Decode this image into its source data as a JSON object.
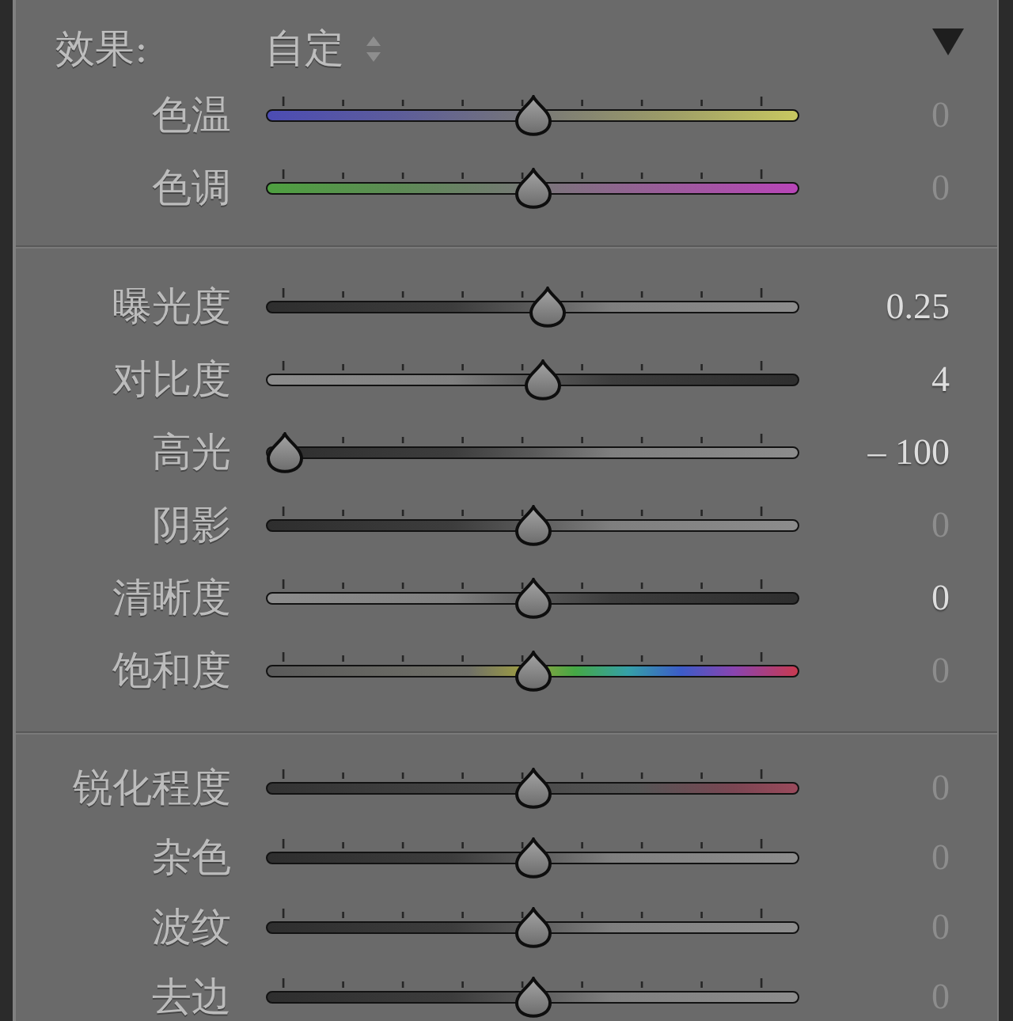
{
  "header": {
    "label": "效果:",
    "preset": "自定"
  },
  "groups": [
    {
      "sliders": [
        {
          "label": "色温",
          "kind": "temperature",
          "level": 0.5,
          "value": "0",
          "highlighted": false
        },
        {
          "label": "色调",
          "kind": "tint",
          "level": 0.5,
          "value": "0",
          "highlighted": false
        }
      ]
    },
    {
      "sliders": [
        {
          "label": "曝光度",
          "kind": "dark-to-light",
          "level": 0.53,
          "value": "0.25",
          "highlighted": true
        },
        {
          "label": "对比度",
          "kind": "light-to-dark",
          "level": 0.52,
          "value": "4",
          "highlighted": true
        },
        {
          "label": "高光",
          "kind": "dark-to-light",
          "level": 0,
          "value": "– 100",
          "highlighted": true
        },
        {
          "label": "阴影",
          "kind": "dark-to-light",
          "level": 0.5,
          "value": "0",
          "highlighted": false
        },
        {
          "label": "清晰度",
          "kind": "light-to-dark",
          "level": 0.5,
          "value": "0",
          "highlighted": true
        },
        {
          "label": "饱和度",
          "kind": "saturation",
          "level": 0.5,
          "value": "0",
          "highlighted": false
        }
      ]
    },
    {
      "sliders": [
        {
          "label": "锐化程度",
          "kind": "sharpness",
          "level": 0.5,
          "value": "0",
          "highlighted": false
        },
        {
          "label": "杂色",
          "kind": "dark-to-light",
          "level": 0.5,
          "value": "0",
          "highlighted": false
        },
        {
          "label": "波纹",
          "kind": "dark-to-light",
          "level": 0.5,
          "value": "0",
          "highlighted": false
        },
        {
          "label": "去边",
          "kind": "dark-to-light",
          "level": 0.5,
          "value": "0",
          "highlighted": false
        }
      ]
    }
  ]
}
